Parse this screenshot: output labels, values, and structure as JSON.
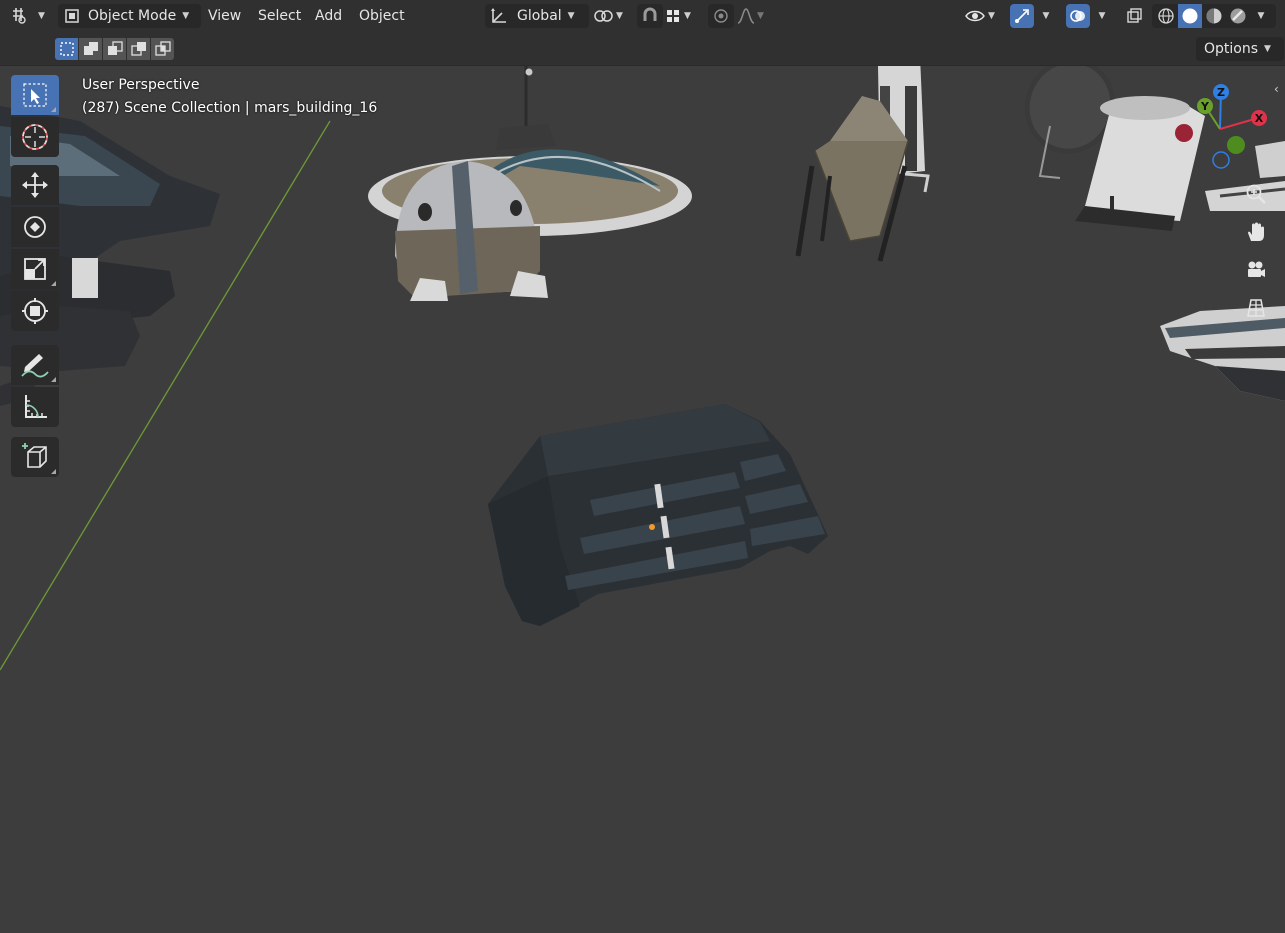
{
  "header": {
    "editor_type_icon": "editor-type-icon",
    "mode": {
      "label": "Object Mode",
      "icon": "object-mode-icon"
    },
    "menus": [
      "View",
      "Select",
      "Add",
      "Object"
    ],
    "transform_orientation": {
      "label": "Global",
      "icon": "transform-orientation-icon"
    },
    "pivot_icon": "pivot-point-icon",
    "snap_icon": "snap-magnet-icon",
    "snap_target_icon": "snap-increment-icon",
    "proportional_icon": "proportional-editing-icon",
    "falloff_icon": "falloff-curve-icon",
    "visibility_icon": "object-visibility-icon",
    "gizmo_icon": "gizmo-toggle-icon",
    "overlay_icon": "overlay-toggle-icon",
    "xray_icon": "xray-toggle-icon",
    "shading": [
      "wireframe-shading-icon",
      "solid-shading-icon",
      "material-preview-icon",
      "rendered-shading-icon"
    ]
  },
  "subheader": {
    "select_modes": [
      "select-new-icon",
      "select-extend-icon",
      "select-subtract-icon",
      "select-invert-icon",
      "select-intersect-icon"
    ],
    "options_label": "Options"
  },
  "viewport": {
    "perspective_label": "User Perspective",
    "collection_label": "(287) Scene Collection | mars_building_16",
    "background_color": "#3d3d3d",
    "grid_line_color": "#6e9a35"
  },
  "toolbar": [
    {
      "name": "select-box-tool",
      "icon": "select-box-icon",
      "active": true
    },
    {
      "name": "cursor-tool",
      "icon": "cursor-icon",
      "active": false
    },
    {
      "name": "move-tool",
      "icon": "move-icon",
      "active": false
    },
    {
      "name": "rotate-tool",
      "icon": "rotate-icon",
      "active": false
    },
    {
      "name": "scale-tool",
      "icon": "scale-icon",
      "active": false
    },
    {
      "name": "transform-tool",
      "icon": "transform-icon",
      "active": false
    },
    {
      "name": "annotate-tool",
      "icon": "annotate-icon",
      "active": false
    },
    {
      "name": "measure-tool",
      "icon": "measure-icon",
      "active": false
    },
    {
      "name": "add-cube-tool",
      "icon": "add-cube-icon",
      "active": false
    }
  ],
  "gizmo": {
    "axes": [
      {
        "label": "Z",
        "color": "#2f7fe5"
      },
      {
        "label": "Y",
        "color": "#6aa12a"
      },
      {
        "label": "X",
        "color": "#e0324b"
      }
    ]
  },
  "nav_buttons": [
    "zoom-icon",
    "pan-hand-icon",
    "camera-view-icon",
    "orthographic-grid-icon"
  ],
  "colors": {
    "accent": "#4772b3",
    "header_bg": "#303030",
    "toolbar_bg": "#2b2b2b"
  }
}
